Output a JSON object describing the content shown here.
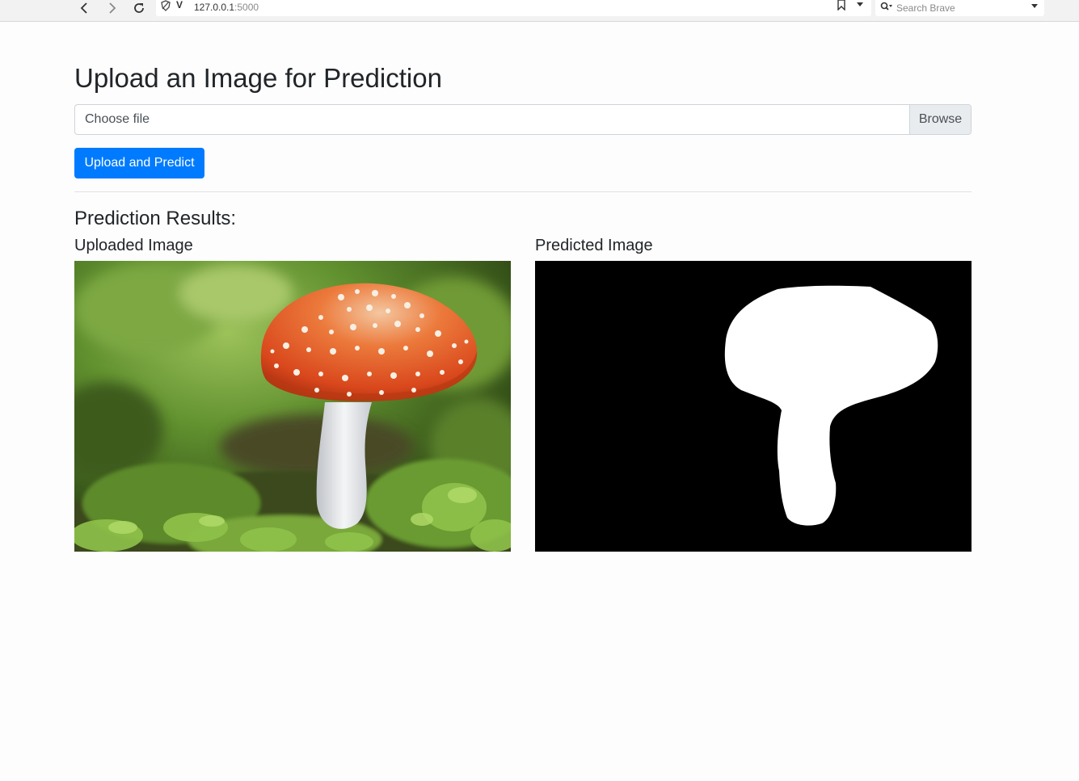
{
  "browser": {
    "url_host": "127.0.0.1",
    "url_port": ":5000",
    "search_placeholder": "Search Brave"
  },
  "page": {
    "title": "Upload an Image for Prediction",
    "file_input": {
      "placeholder": "Choose file",
      "browse_label": "Browse"
    },
    "submit_label": "Upload and Predict",
    "results_heading": "Prediction Results:",
    "uploaded_heading": "Uploaded Image",
    "predicted_heading": "Predicted Image"
  },
  "colors": {
    "primary": "#007bff",
    "text": "#212529"
  }
}
